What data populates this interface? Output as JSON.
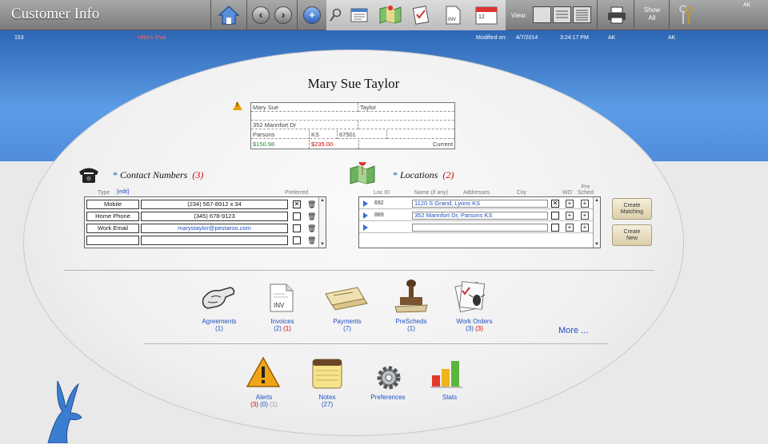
{
  "app": {
    "title": "Customer Info"
  },
  "toolbar": {
    "view_label": "View:",
    "show_all_label": "Show\nAll",
    "user_badge": "AK"
  },
  "info_strip": {
    "record_id": "153",
    "device": "Mike's iPad",
    "modified_label": "Modified on:",
    "modified_date": "4/7/2014",
    "modified_time": "3:24:17 PM",
    "user_code_1": "AK",
    "user_code_2": "AK"
  },
  "customer": {
    "full_name": "Mary Sue Taylor",
    "first_name": "Mary Sue",
    "last_name": "Taylor",
    "address_line1": "",
    "address_line2": "352 Mannfort Dr",
    "city": "Parsons",
    "state": "KS",
    "zip": "67501",
    "balance_paid": "$150.98",
    "balance_due": "$235.00",
    "balance_status": "Current"
  },
  "contacts": {
    "title": "Contact Numbers",
    "count": "(3)",
    "col_type": "Type",
    "edit_link": "[edit]",
    "col_preferred": "Preferred",
    "rows": [
      {
        "type": "Mobile",
        "value": "(234) 567-8912 x 34",
        "preferred": true
      },
      {
        "type": "Home Phone",
        "value": "(345) 678-9123",
        "preferred": false
      },
      {
        "type": "Work Email",
        "value": "marystaylor@pestaroo.com",
        "preferred": false
      },
      {
        "type": "",
        "value": "",
        "preferred": false
      }
    ]
  },
  "locations": {
    "title": "Locations",
    "count": "(2)",
    "col_loc_id": "Loc ID",
    "col_name": "Name (if any)",
    "col_addresses": "Addresses",
    "col_city": "City",
    "col_wo": "WO",
    "col_pre_sched": "Pre\nSched",
    "rows": [
      {
        "loc_id": "692",
        "address": "1120 S Grand,  Lyons  KS",
        "checked": true
      },
      {
        "loc_id": "889",
        "address": "352 Mannfort Dr,  Parsons  KS",
        "checked": false
      },
      {
        "loc_id": "",
        "address": "",
        "checked": false
      }
    ],
    "create_matching_label": "Create\nMatching",
    "create_new_label": "Create\nNew"
  },
  "modules": {
    "agreements": {
      "label": "Agreements",
      "count": "(1)"
    },
    "invoices": {
      "label": "Invoices",
      "count_a": "(2)",
      "count_b": "(1)",
      "icon_text": "INV"
    },
    "payments": {
      "label": "Payments",
      "count": "(7)"
    },
    "prescheds": {
      "label": "PreScheds",
      "count": "(1)"
    },
    "work_orders": {
      "label": "Work Orders",
      "count_a": "(3)",
      "count_b": "(3)"
    },
    "more_label": "More ...",
    "alerts": {
      "label": "Alerts",
      "count_a": "(3)",
      "count_b": "(0)",
      "count_c": "(1)"
    },
    "notes": {
      "label": "Notes",
      "count": "(27)"
    },
    "preferences": {
      "label": "Preferences"
    },
    "stats": {
      "label": "Stats"
    }
  },
  "colors": {
    "header_blue": "#2d67b4",
    "link_blue": "#1e4fbf",
    "alert_red": "#d40000",
    "paid_green": "#2a8a2a"
  }
}
